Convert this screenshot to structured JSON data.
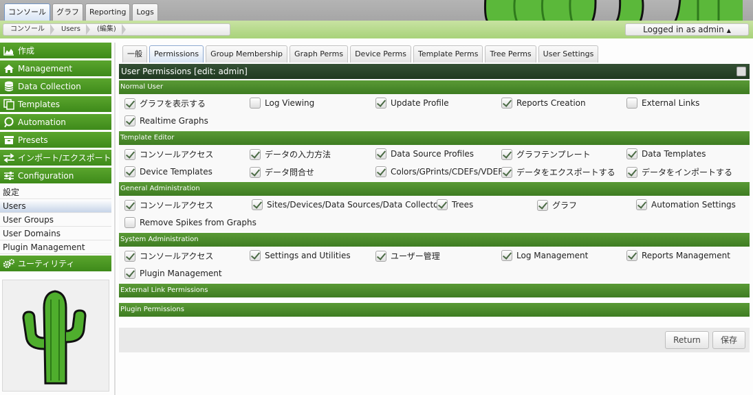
{
  "main_tabs": [
    {
      "label": "コンソール",
      "active": true
    },
    {
      "label": "グラフ",
      "active": false
    },
    {
      "label": "Reporting",
      "active": false
    },
    {
      "label": "Logs",
      "active": false
    }
  ],
  "breadcrumb": [
    "コンソール",
    "Users",
    "(編集)"
  ],
  "user_menu": {
    "label": "Logged in as admin",
    "caret": "▲"
  },
  "sidebar": {
    "headers": [
      {
        "label": "作成",
        "icon": "area-chart-icon"
      },
      {
        "label": "Management",
        "icon": "home-icon"
      },
      {
        "label": "Data Collection",
        "icon": "database-icon"
      },
      {
        "label": "Templates",
        "icon": "copy-icon"
      },
      {
        "label": "Automation",
        "icon": "automation-icon"
      },
      {
        "label": "Presets",
        "icon": "archive-icon"
      },
      {
        "label": "インポート/エクスポート",
        "icon": "exchange-icon"
      },
      {
        "label": "Configuration",
        "icon": "sliders-icon"
      }
    ],
    "sub_items": [
      "設定",
      "Users",
      "User Groups",
      "User Domains",
      "Plugin Management"
    ],
    "active_sub": "Users",
    "utilities": {
      "label": "ユーティリティ",
      "icon": "gears-icon"
    }
  },
  "sub_tabs": [
    {
      "label": "一般",
      "active": false
    },
    {
      "label": "Permissions",
      "active": true
    },
    {
      "label": "Group Membership",
      "active": false
    },
    {
      "label": "Graph Perms",
      "active": false
    },
    {
      "label": "Device Perms",
      "active": false
    },
    {
      "label": "Template Perms",
      "active": false
    },
    {
      "label": "Tree Perms",
      "active": false
    },
    {
      "label": "User Settings",
      "active": false
    }
  ],
  "panel_title": "User Permissions [edit: admin]",
  "sections": [
    {
      "title": "Normal User",
      "rows": [
        [
          {
            "label": "グラフを表示する",
            "checked": true
          },
          {
            "label": "Log Viewing",
            "checked": false
          },
          {
            "label": "Update Profile",
            "checked": true
          },
          {
            "label": "Reports Creation",
            "checked": true
          },
          {
            "label": "External Links",
            "checked": false
          }
        ],
        [
          {
            "label": "Realtime Graphs",
            "checked": true
          }
        ]
      ]
    },
    {
      "title": "Template Editor",
      "rows": [
        [
          {
            "label": "コンソールアクセス",
            "checked": true
          },
          {
            "label": "データの入力方法",
            "checked": true
          },
          {
            "label": "Data Source Profiles",
            "checked": true
          },
          {
            "label": "グラフテンプレート",
            "checked": true
          },
          {
            "label": "Data Templates",
            "checked": true
          }
        ],
        [
          {
            "label": "Device Templates",
            "checked": true
          },
          {
            "label": "データ問合せ",
            "checked": true
          },
          {
            "label": "Colors/GPrints/CDEFs/VDEFs",
            "checked": true
          },
          {
            "label": "データをエクスポートする",
            "checked": true
          },
          {
            "label": "データをインポートする",
            "checked": true
          }
        ]
      ]
    },
    {
      "title": "General Administration",
      "rows": [
        [
          {
            "label": "コンソールアクセス",
            "checked": true
          },
          {
            "label": "Sites/Devices/Data Sources/Data Collectors",
            "checked": true
          },
          {
            "label": "Trees",
            "checked": true
          },
          {
            "label": "グラフ",
            "checked": true
          },
          {
            "label": "Automation Settings",
            "checked": true
          }
        ],
        [
          {
            "label": "Remove Spikes from Graphs",
            "checked": false
          }
        ]
      ]
    },
    {
      "title": "System Administration",
      "rows": [
        [
          {
            "label": "コンソールアクセス",
            "checked": true
          },
          {
            "label": "Settings and Utilities",
            "checked": true
          },
          {
            "label": "ユーザー管理",
            "checked": true
          },
          {
            "label": "Log Management",
            "checked": true
          },
          {
            "label": "Reports Management",
            "checked": true
          }
        ],
        [
          {
            "label": "Plugin Management",
            "checked": true
          }
        ]
      ]
    },
    {
      "title": "External Link Permissions",
      "rows": []
    },
    {
      "title": "Plugin Permissions",
      "rows": []
    }
  ],
  "buttons": {
    "return": "Return",
    "save": "保存"
  },
  "colors": {
    "sidebar_green": "#4a961f",
    "panel_dark": "#2b462b",
    "section_green": "#4d8a2c"
  }
}
